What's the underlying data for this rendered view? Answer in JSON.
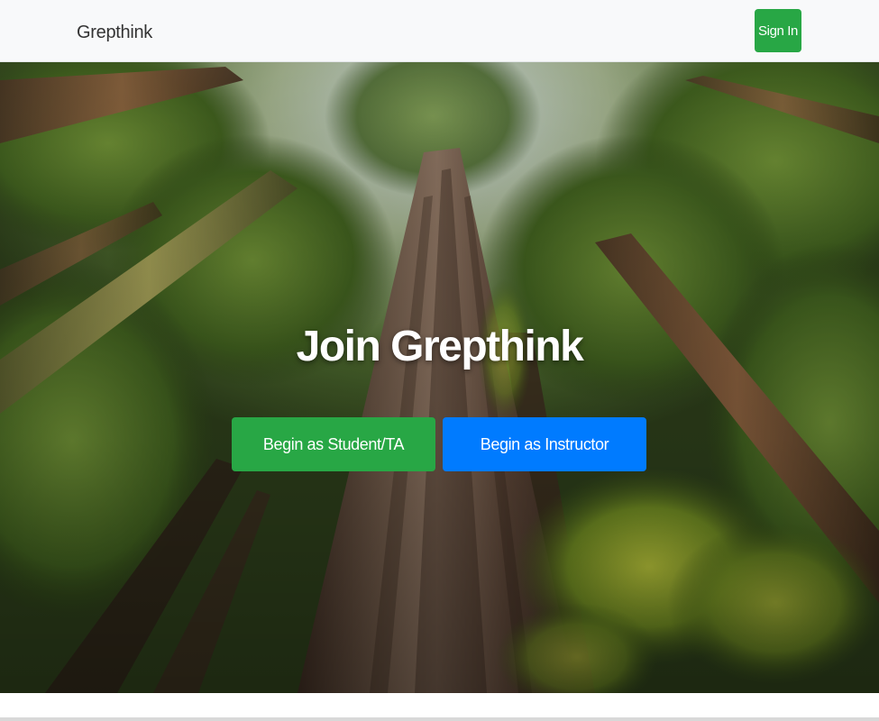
{
  "navbar": {
    "brand": "Grepthink",
    "signin_label": "Sign In"
  },
  "hero": {
    "title": "Join Grepthink",
    "student_button_label": "Begin as Student/TA",
    "instructor_button_label": "Begin as Instructor",
    "background_description_icon": "redwood-forest-image"
  },
  "colors": {
    "success": "#28a745",
    "primary": "#007bff",
    "navbar_bg": "#f8f9fa"
  }
}
